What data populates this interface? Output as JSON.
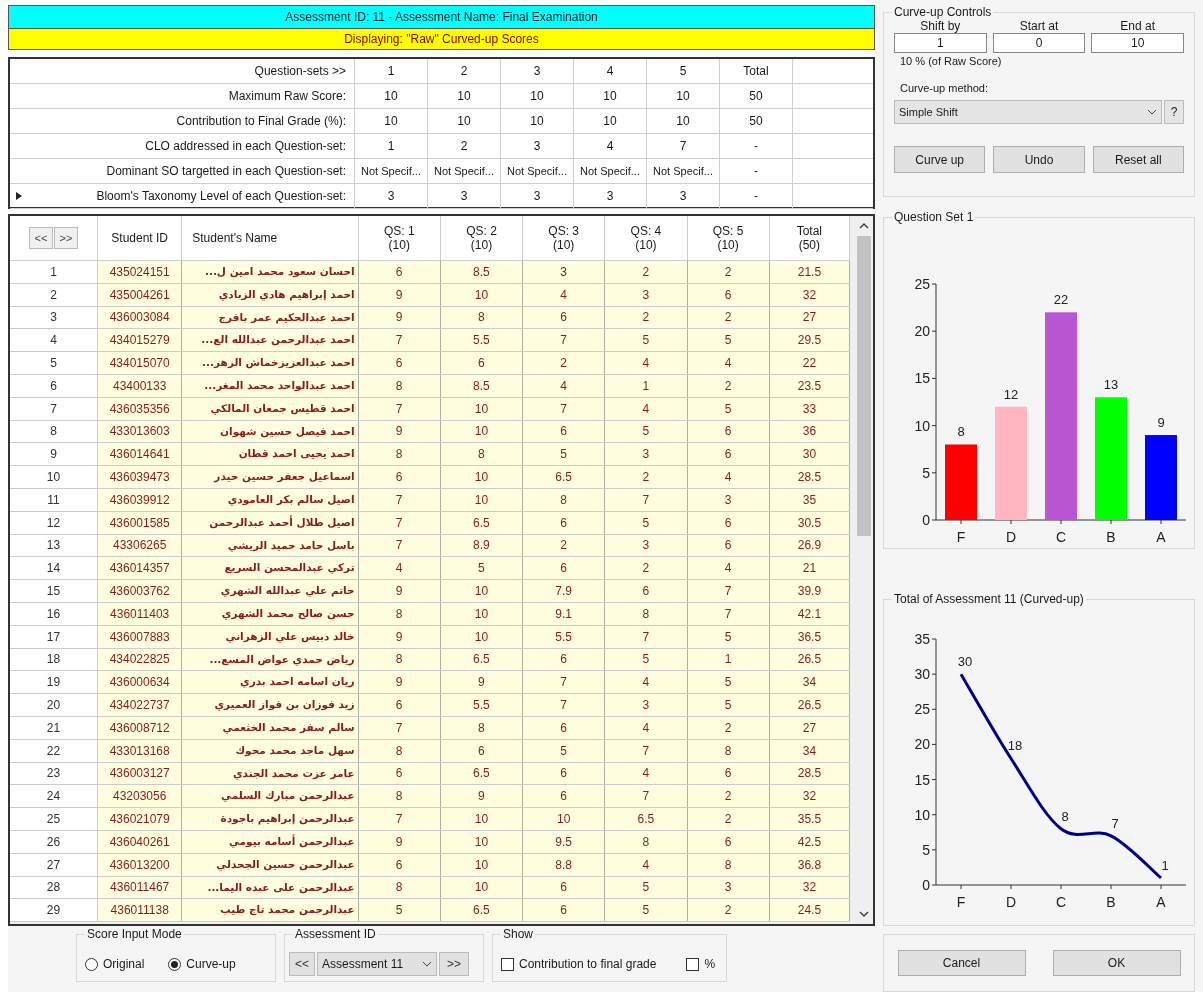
{
  "header": {
    "title": "Assessment ID:  11  -  Assessment Name: Final Examination",
    "subtitle": "Displaying: \"Raw\" Curved-up Scores"
  },
  "summary": {
    "rows": [
      {
        "label": "Question-sets >>",
        "values": [
          "1",
          "2",
          "3",
          "4",
          "5",
          "Total"
        ],
        "current": false
      },
      {
        "label": "Maximum Raw Score:",
        "values": [
          "10",
          "10",
          "10",
          "10",
          "10",
          "50"
        ],
        "current": false
      },
      {
        "label": "Contribution to Final Grade (%):",
        "values": [
          "10",
          "10",
          "10",
          "10",
          "10",
          "50"
        ],
        "current": false
      },
      {
        "label": "CLO addressed in each Question-set:",
        "values": [
          "1",
          "2",
          "3",
          "4",
          "7",
          "-"
        ],
        "current": false
      },
      {
        "label": "Dominant SO targetted in each Question-set:",
        "values": [
          "Not Specif...",
          "Not Specif...",
          "Not Specif...",
          "Not Specif...",
          "Not Specif...",
          "-"
        ],
        "current": false
      },
      {
        "label": "Bloom's Taxonomy Level of each Question-set:",
        "values": [
          "3",
          "3",
          "3",
          "3",
          "3",
          "-"
        ],
        "current": true
      }
    ]
  },
  "grid": {
    "nav_buttons": [
      "<<",
      ">>"
    ],
    "columns": [
      {
        "title": "Student ID"
      },
      {
        "title": "Student's Name"
      },
      {
        "title": "QS: 1",
        "max": "(10)"
      },
      {
        "title": "QS: 2",
        "max": "(10)"
      },
      {
        "title": "QS: 3",
        "max": "(10)"
      },
      {
        "title": "QS: 4",
        "max": "(10)"
      },
      {
        "title": "QS: 5",
        "max": "(10)"
      },
      {
        "title": "Total",
        "max": "(50)"
      }
    ],
    "rows": [
      {
        "number": "1",
        "cells": [
          "435024151",
          "احسان سعود محمد امين ل...",
          "6",
          "8.5",
          "3",
          "2",
          "2",
          "21.5"
        ]
      },
      {
        "number": "2",
        "cells": [
          "435004261",
          "احمد إبراهيم هادي الزبادي",
          "9",
          "10",
          "4",
          "3",
          "6",
          "32"
        ]
      },
      {
        "number": "3",
        "cells": [
          "436003084",
          "احمد عبدالحكيم عمر بافرج",
          "9",
          "8",
          "6",
          "2",
          "2",
          "27"
        ]
      },
      {
        "number": "4",
        "cells": [
          "434015279",
          "احمد عبدالرحمن عبدالله الع...",
          "7",
          "5.5",
          "7",
          "5",
          "5",
          "29.5"
        ]
      },
      {
        "number": "5",
        "cells": [
          "434015070",
          "احمد عبدالعزيزخماش الزهر...",
          "6",
          "6",
          "2",
          "4",
          "4",
          "22"
        ]
      },
      {
        "number": "6",
        "cells": [
          "43400133",
          "احمد عبدالواحد محمد المغر...",
          "8",
          "8.5",
          "4",
          "1",
          "2",
          "23.5"
        ]
      },
      {
        "number": "7",
        "cells": [
          "436035356",
          "احمد قطيس جمعان المالكي",
          "7",
          "10",
          "7",
          "4",
          "5",
          "33"
        ]
      },
      {
        "number": "8",
        "cells": [
          "433013603",
          "احمد فيصل حسين شهوان",
          "9",
          "10",
          "6",
          "5",
          "6",
          "36"
        ]
      },
      {
        "number": "9",
        "cells": [
          "436014641",
          "احمد يحيى احمد قطان",
          "8",
          "8",
          "5",
          "3",
          "6",
          "30"
        ]
      },
      {
        "number": "10",
        "cells": [
          "436039473",
          "اسماعيل جعفر حسين حيدر",
          "6",
          "10",
          "6.5",
          "2",
          "4",
          "28.5"
        ]
      },
      {
        "number": "11",
        "cells": [
          "436039912",
          "اصيل سالم بكر العامودي",
          "7",
          "10",
          "8",
          "7",
          "3",
          "35"
        ]
      },
      {
        "number": "12",
        "cells": [
          "436001585",
          "اصيل طلال أحمد عبدالرحمن",
          "7",
          "6.5",
          "6",
          "5",
          "6",
          "30.5"
        ]
      },
      {
        "number": "13",
        "cells": [
          "43306265",
          "باسل حامد حميد الريشي",
          "7",
          "8.9",
          "2",
          "3",
          "6",
          "26.9"
        ]
      },
      {
        "number": "14",
        "cells": [
          "436014357",
          "تركي عبدالمحسن السريع",
          "4",
          "5",
          "6",
          "2",
          "4",
          "21"
        ]
      },
      {
        "number": "15",
        "cells": [
          "436003762",
          "حاتم علي عبدالله الشهري",
          "9",
          "10",
          "7.9",
          "6",
          "7",
          "39.9"
        ]
      },
      {
        "number": "16",
        "cells": [
          "436011403",
          "حسن صالح محمد الشهري",
          "8",
          "10",
          "9.1",
          "8",
          "7",
          "42.1"
        ]
      },
      {
        "number": "17",
        "cells": [
          "436007883",
          "خالد دبيس علي الزهراني",
          "9",
          "10",
          "5.5",
          "7",
          "5",
          "36.5"
        ]
      },
      {
        "number": "18",
        "cells": [
          "434022825",
          "رياض حمدي عواض المسع...",
          "8",
          "6.5",
          "6",
          "5",
          "1",
          "26.5"
        ]
      },
      {
        "number": "19",
        "cells": [
          "436000634",
          "ريان اسامه احمد بدري",
          "9",
          "9",
          "7",
          "4",
          "5",
          "34"
        ]
      },
      {
        "number": "20",
        "cells": [
          "434022737",
          "زيد فوزان بن فواز العميري",
          "6",
          "5.5",
          "7",
          "3",
          "5",
          "26.5"
        ]
      },
      {
        "number": "21",
        "cells": [
          "436008712",
          "سالم سفر محمد الخثعمي",
          "7",
          "8",
          "6",
          "4",
          "2",
          "27"
        ]
      },
      {
        "number": "22",
        "cells": [
          "433013168",
          "سهل ماجد محمد محوك",
          "8",
          "6",
          "5",
          "7",
          "8",
          "34"
        ]
      },
      {
        "number": "23",
        "cells": [
          "436003127",
          "عامر عزت محمد الجندي",
          "6",
          "6.5",
          "6",
          "4",
          "6",
          "28.5"
        ]
      },
      {
        "number": "24",
        "cells": [
          "43203056",
          "عبدالرحمن مبارك السلمي",
          "8",
          "9",
          "6",
          "7",
          "2",
          "32"
        ]
      },
      {
        "number": "25",
        "cells": [
          "436021079",
          "عبدالرحمن إبراهيم باجودة",
          "7",
          "10",
          "10",
          "6.5",
          "2",
          "35.5"
        ]
      },
      {
        "number": "26",
        "cells": [
          "436040261",
          "عبدالرحمن أسامه بيومي",
          "9",
          "10",
          "9.5",
          "8",
          "6",
          "42.5"
        ]
      },
      {
        "number": "27",
        "cells": [
          "436013200",
          "عبدالرحمن حسين الجحدلي",
          "6",
          "10",
          "8.8",
          "4",
          "8",
          "36.8"
        ]
      },
      {
        "number": "28",
        "cells": [
          "436011467",
          "عبدالرحمن على عبده اليما...",
          "8",
          "10",
          "6",
          "5",
          "3",
          "32"
        ]
      },
      {
        "number": "29",
        "cells": [
          "436011138",
          "عبدالرحمن محمد تاج طيب",
          "5",
          "6.5",
          "6",
          "5",
          "2",
          "24.5"
        ]
      }
    ]
  },
  "curve_controls": {
    "title": "Curve-up Controls",
    "fields": [
      {
        "label": "Shift by",
        "value": "1"
      },
      {
        "label": "Start at",
        "value": "0"
      },
      {
        "label": "End at",
        "value": "10"
      }
    ],
    "note": "10 % (of Raw Score)",
    "method_label": "Curve-up method:",
    "method": "Simple Shift",
    "help": "?",
    "buttons": [
      "Curve up",
      "Undo",
      "Reset all"
    ]
  },
  "question_set_panel": {
    "title": "Question Set  1",
    "chart_data": {
      "type": "bar",
      "categories": [
        "F",
        "D",
        "C",
        "B",
        "A"
      ],
      "values": [
        8,
        12,
        22,
        13,
        9
      ],
      "ylim": [
        0,
        25
      ],
      "yticks": [
        0,
        5,
        10,
        15,
        20,
        25
      ],
      "data_labels": true
    }
  },
  "total_panel": {
    "title": "Total of Assessment  11 (Curved-up)",
    "chart_data": {
      "type": "line",
      "categories": [
        "F",
        "D",
        "C",
        "B",
        "A"
      ],
      "series": [
        {
          "color": "#00008b",
          "values": [
            30,
            18,
            8,
            7,
            1
          ]
        }
      ],
      "ylim": [
        0,
        35
      ],
      "yticks": [
        0,
        5,
        10,
        15,
        20,
        25,
        30,
        35
      ],
      "data_labels": true
    }
  },
  "score_input_mode": {
    "title": "Score Input Mode",
    "options": [
      {
        "label": "Original",
        "selected": false
      },
      {
        "label": "Curve-up",
        "selected": true
      }
    ]
  },
  "assessment_id": {
    "title": "Assessment ID",
    "prev": "<<",
    "value": "Assessment 11",
    "next": ">>"
  },
  "show": {
    "title": "Show",
    "checkboxes": [
      {
        "label": "Contribution to final grade",
        "checked": false
      },
      {
        "label": "%",
        "checked": false
      }
    ]
  },
  "dialog_buttons": [
    "Cancel",
    "OK"
  ]
}
